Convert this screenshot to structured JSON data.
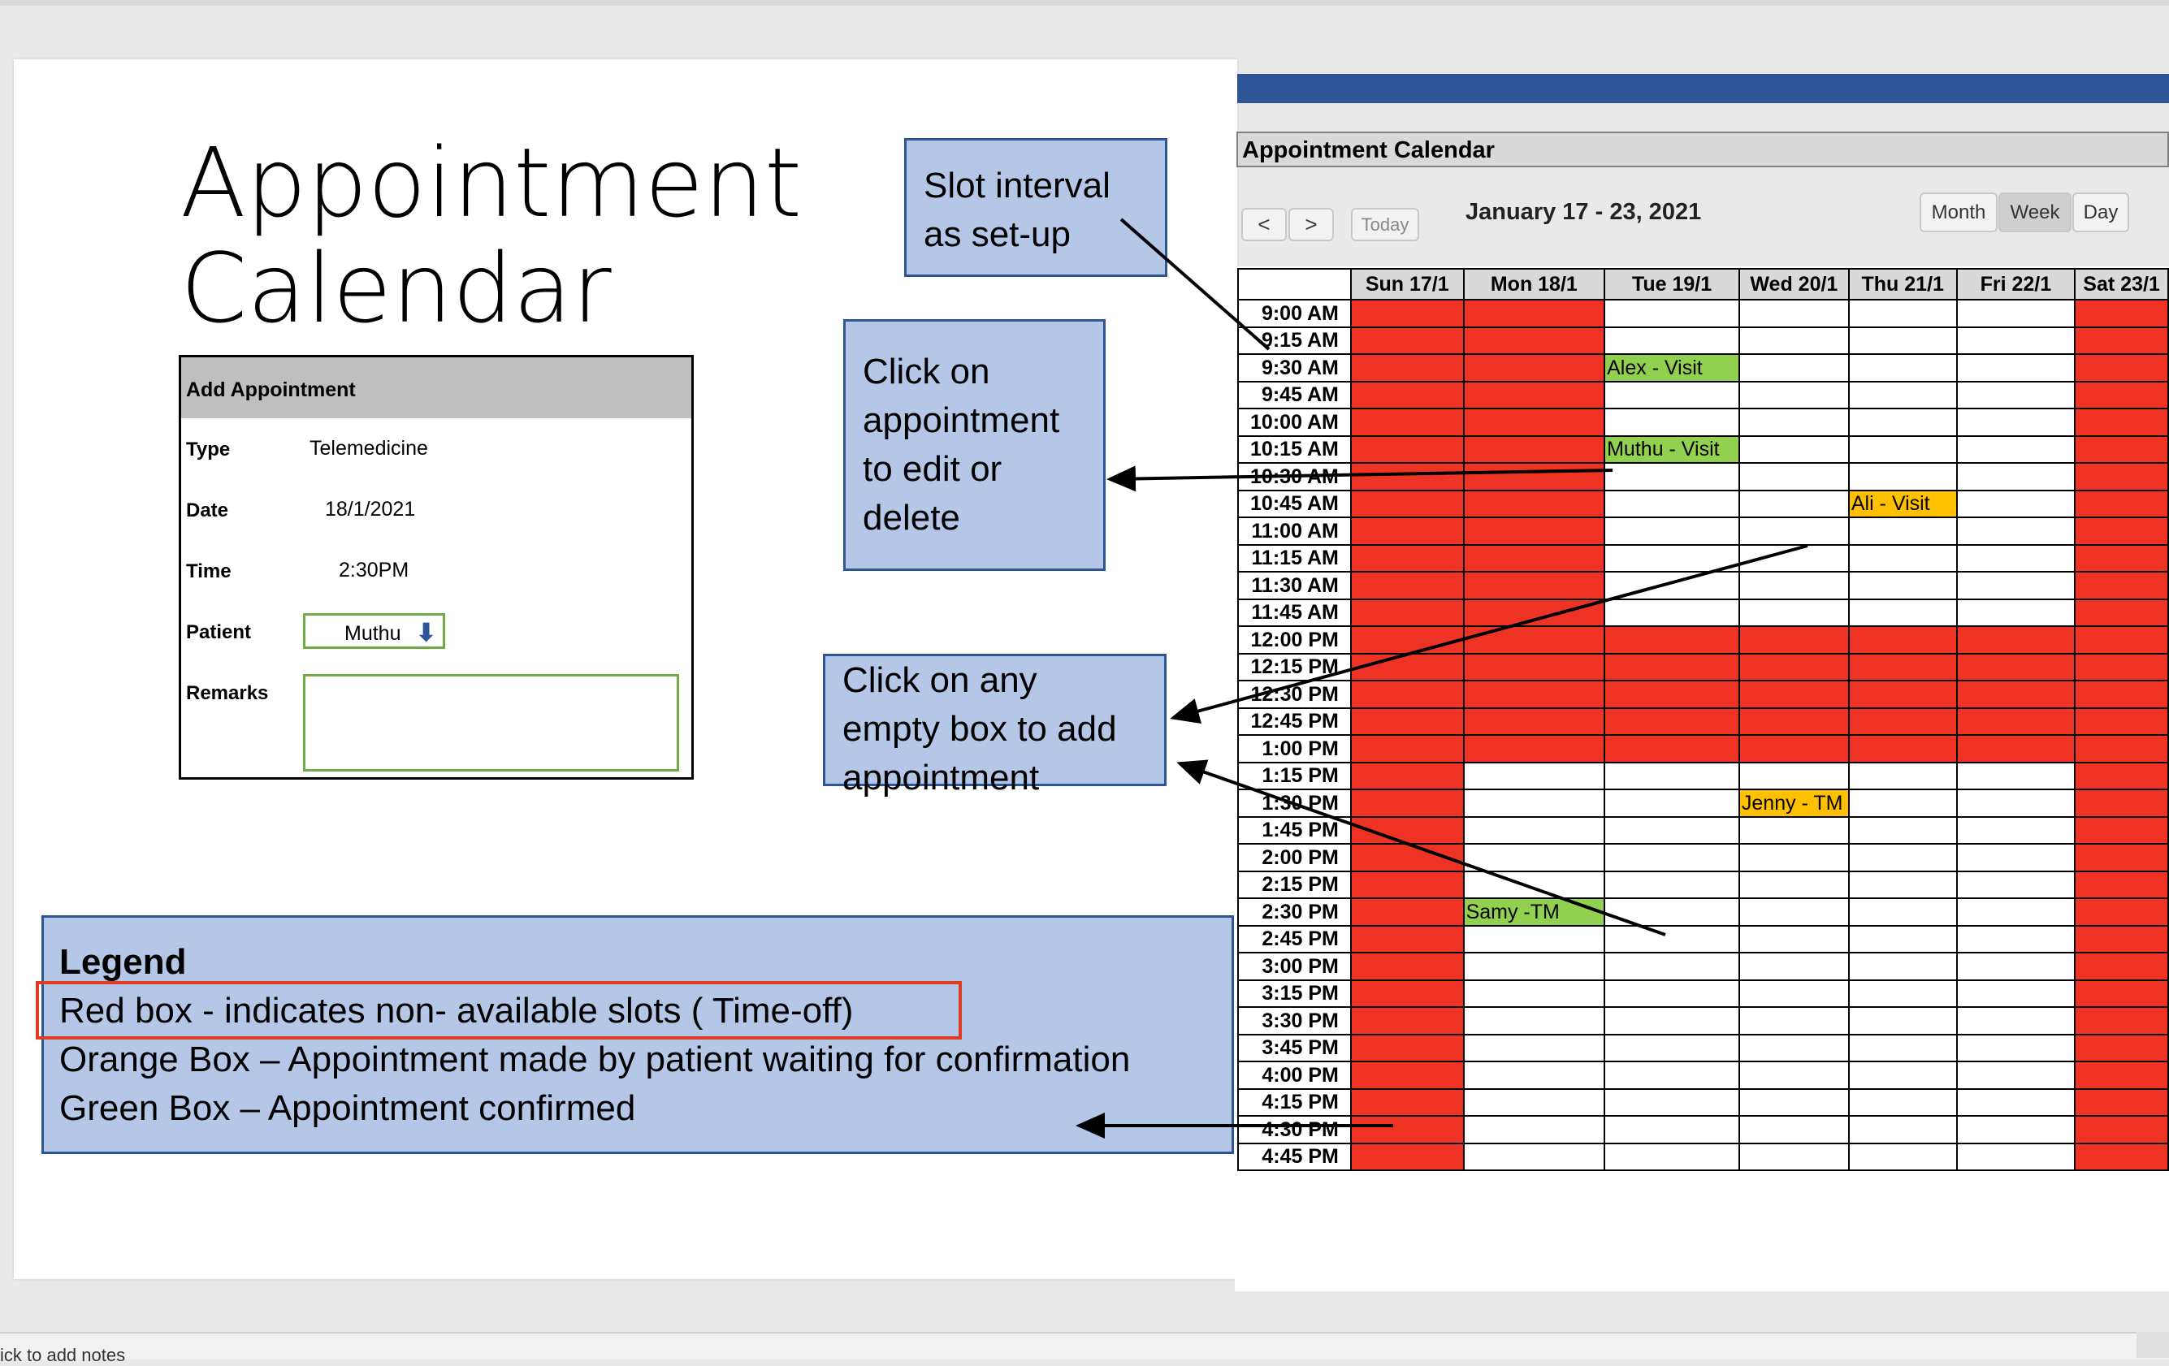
{
  "slide": {
    "title_line1": "Appointment",
    "title_line2": "Calendar",
    "notes_placeholder": "ick to add notes"
  },
  "form": {
    "header": "Add Appointment",
    "fields": [
      {
        "label": "Type",
        "value": "Telemedicine"
      },
      {
        "label": "Date",
        "value": "18/1/2021"
      },
      {
        "label": "Time",
        "value": "2:30PM"
      },
      {
        "label": "Patient",
        "value": "Muthu"
      },
      {
        "label": "Remarks",
        "value": ""
      }
    ],
    "patient_icon": "arrow-down-icon"
  },
  "callouts": {
    "slot_interval": [
      "Slot interval",
      "as  set-up"
    ],
    "click_appointment": [
      "Click on",
      "appointment",
      "to edit or",
      "delete"
    ],
    "click_empty": [
      "Click on any",
      "empty box to add",
      "appointment"
    ]
  },
  "legend": {
    "title": "Legend",
    "lines": [
      "Red box - indicates non- available slots ( Time-off)",
      "Orange Box – Appointment made by patient waiting for confirmation",
      "Green Box – Appointment confirmed"
    ]
  },
  "calendar": {
    "title": "Appointment Calendar",
    "prev_icon": "chevron-left-icon",
    "next_icon": "chevron-right-icon",
    "prev_glyph": "<",
    "next_glyph": ">",
    "today": "Today",
    "range": "January 17 -  23, 2021",
    "views": [
      "Month",
      "Week",
      "Day"
    ],
    "active_view": "Week",
    "days": [
      "Sun 17/1",
      "Mon 18/1",
      "Tue 19/1",
      "Wed 20/1",
      "Thu 21/1",
      "Fri 22/1",
      "Sat 23/1"
    ],
    "times": [
      "9:00 AM",
      "9:15 AM",
      "9:30 AM",
      "9:45 AM",
      "10:00 AM",
      "10:15 AM",
      "10:30 AM",
      "10:45 AM",
      "11:00 AM",
      "11:15 AM",
      "11:30 AM",
      "11:45 AM",
      "12:00 PM",
      "12:15 PM",
      "12:30 PM",
      "12:45 PM",
      "1:00 PM",
      "1:15 PM",
      "1:30 PM",
      "1:45 PM",
      "2:00 PM",
      "2:15 PM",
      "2:30 PM",
      "2:45 PM",
      "3:00 PM",
      "3:15 PM",
      "3:30 PM",
      "3:45 PM",
      "4:00 PM",
      "4:15 PM",
      "4:30 PM",
      "4:45 PM"
    ],
    "status_colors": {
      "red": "#ee3224",
      "green": "#92d050",
      "orange": "#ffc000"
    },
    "unavailable": {
      "full_days": [
        0,
        6
      ],
      "mon_until_row": 16,
      "all_days_rows": [
        12,
        13,
        14,
        15,
        16
      ]
    },
    "appointments": [
      {
        "day": 2,
        "row": 2,
        "label": "Alex - Visit",
        "status": "green"
      },
      {
        "day": 2,
        "row": 5,
        "label": "Muthu - Visit",
        "status": "green"
      },
      {
        "day": 4,
        "row": 7,
        "label": "Ali - Visit",
        "status": "orange"
      },
      {
        "day": 3,
        "row": 18,
        "label": "Jenny - TM",
        "status": "orange"
      },
      {
        "day": 1,
        "row": 22,
        "label": "Samy -TM",
        "status": "green"
      }
    ]
  }
}
